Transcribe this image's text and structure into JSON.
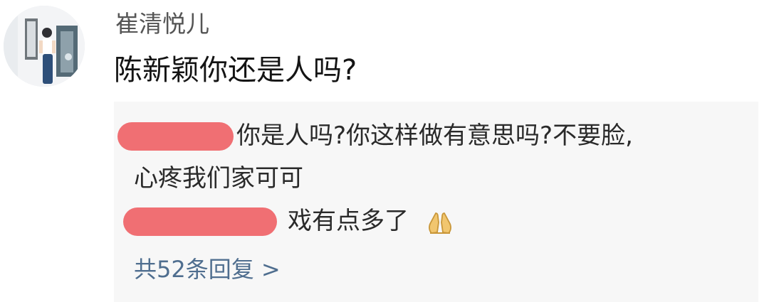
{
  "comment": {
    "username": "崔清悦儿",
    "text": "陈新颖你还是人吗?"
  },
  "replies": [
    {
      "lines": [
        "你是人吗?你这样做有意思吗?不要脸,",
        "心疼我们家可可"
      ]
    },
    {
      "text": "戏有点多了",
      "emoji": "pray-hands-emoji"
    }
  ],
  "reply_count_label": "共52条回复 >",
  "colors": {
    "redaction": "#f06f73",
    "reply_box_bg": "#f7f7f7",
    "link": "#4f6e8f"
  }
}
